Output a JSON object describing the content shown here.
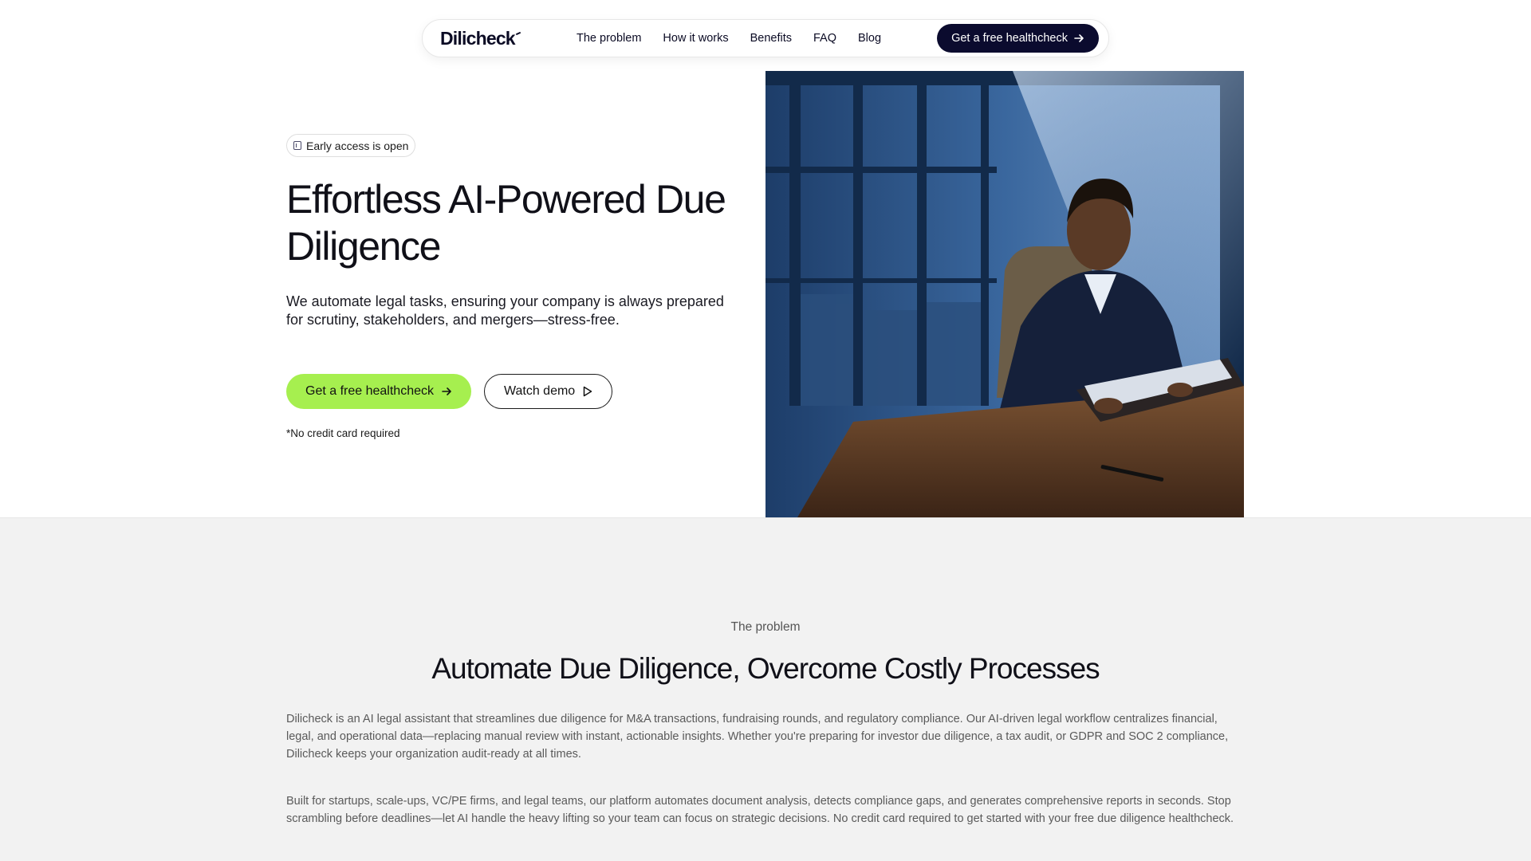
{
  "nav": {
    "logo": "Dilicheck",
    "links": [
      "The problem",
      "How it works",
      "Benefits",
      "FAQ",
      "Blog"
    ],
    "cta": "Get a free healthcheck"
  },
  "hero": {
    "badge": "Early access is open",
    "title_line1": "Effortless AI-Powered Due",
    "title_line2": "Diligence",
    "subtitle": "We automate legal tasks, ensuring your company is always prepared for scrutiny, stakeholders, and mergers—stress-free.",
    "primary_cta": "Get a free healthcheck",
    "secondary_cta": "Watch demo",
    "note": "*No credit card required"
  },
  "problem": {
    "eyebrow": "The problem",
    "title": "Automate Due Diligence, Overcome Costly Processes",
    "paragraph1": "Dilicheck is an AI legal assistant that streamlines due diligence for M&A transactions, fundraising rounds, and regulatory compliance. Our AI-driven legal workflow centralizes financial, legal, and operational data—replacing manual review with instant, actionable insights. Whether you're preparing for investor due diligence, a tax audit, or GDPR and SOC 2 compliance, Dilicheck keeps your organization audit-ready at all times.",
    "paragraph2": "Built for startups, scale-ups, VC/PE firms, and legal teams, our platform automates document analysis, detects compliance gaps, and generates comprehensive reports in seconds. Stop scrambling before deadlines—let AI handle the heavy lifting so your team can focus on strategic decisions. No credit card required to get started with your free due diligence healthcheck."
  },
  "colors": {
    "accent_green": "#a6ef4f",
    "navy": "#0b0b2e",
    "section_gray": "#f2f2f2"
  },
  "icons": {
    "badge": "building-icon",
    "arrow": "arrow-right-icon",
    "play": "play-icon"
  }
}
